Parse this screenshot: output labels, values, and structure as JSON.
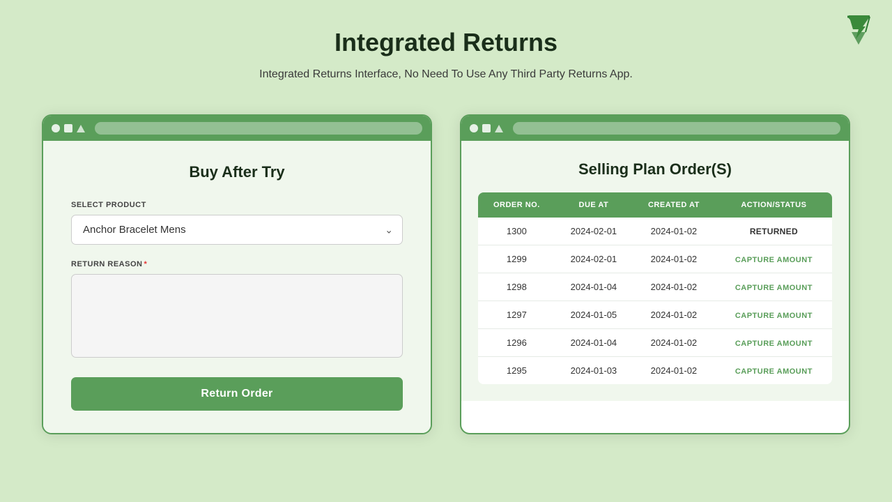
{
  "page": {
    "title": "Integrated Returns",
    "subtitle": "Integrated Returns Interface, No Need To Use Any Third Party Returns App."
  },
  "left_panel": {
    "title": "Buy After Try",
    "select_product_label": "SELECT PRODUCT",
    "selected_product": "Anchor Bracelet Mens",
    "return_reason_label": "RETURN REASON",
    "return_reason_required": true,
    "return_reason_placeholder": "",
    "return_button_label": "Return Order"
  },
  "right_panel": {
    "title": "Selling Plan Order(S)",
    "table": {
      "columns": [
        "ORDER NO.",
        "DUE AT",
        "CREATED AT",
        "ACTION/STATUS"
      ],
      "rows": [
        {
          "order_no": "1300",
          "due_at": "2024-02-01",
          "created_at": "2024-01-02",
          "action": "RETURNED",
          "action_type": "status"
        },
        {
          "order_no": "1299",
          "due_at": "2024-02-01",
          "created_at": "2024-01-02",
          "action": "CAPTURE AMOUNT",
          "action_type": "link"
        },
        {
          "order_no": "1298",
          "due_at": "2024-01-04",
          "created_at": "2024-01-02",
          "action": "CAPTURE AMOUNT",
          "action_type": "link"
        },
        {
          "order_no": "1297",
          "due_at": "2024-01-05",
          "created_at": "2024-01-02",
          "action": "CAPTURE AMOUNT",
          "action_type": "link"
        },
        {
          "order_no": "1296",
          "due_at": "2024-01-04",
          "created_at": "2024-01-02",
          "action": "CAPTURE AMOUNT",
          "action_type": "link"
        },
        {
          "order_no": "1295",
          "due_at": "2024-01-03",
          "created_at": "2024-01-02",
          "action": "CAPTURE AMOUNT",
          "action_type": "link"
        }
      ]
    }
  }
}
